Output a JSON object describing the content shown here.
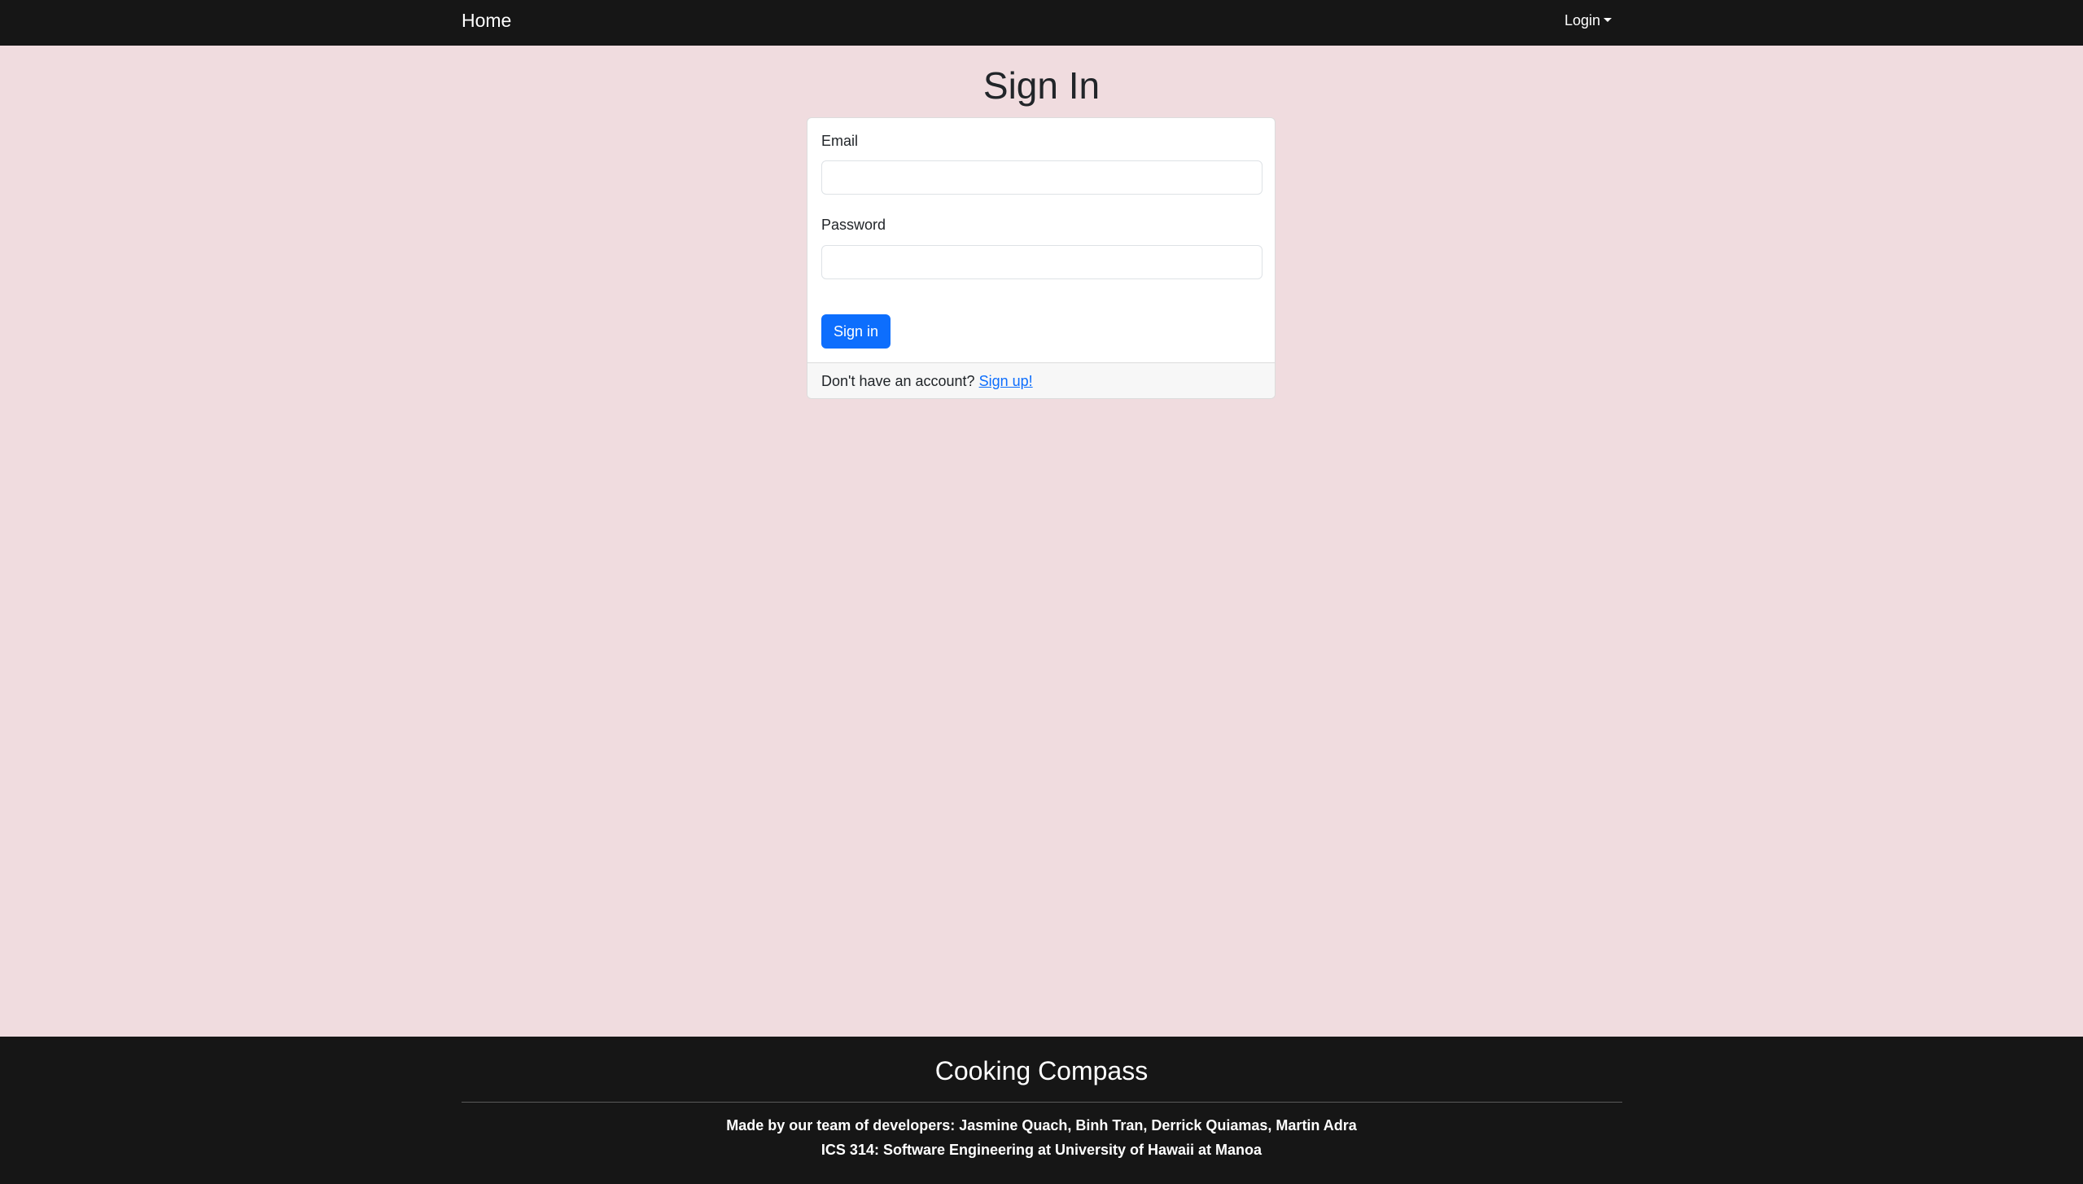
{
  "navbar": {
    "home_label": "Home",
    "login_label": "Login"
  },
  "signin": {
    "title": "Sign In",
    "email_label": "Email",
    "email_value": "",
    "password_label": "Password",
    "password_value": "",
    "submit_label": "Sign in",
    "footer_text": "Don't have an account?",
    "signup_link": "Sign up!"
  },
  "footer": {
    "title": "Cooking Compass",
    "credits": "Made by our team of developers: Jasmine Quach, Binh Tran, Derrick Quiamas, Martin Adra",
    "course": "ICS 314: Software Engineering at University of Hawaii at Manoa"
  },
  "colors": {
    "background": "#f0dcdf",
    "navbar": "#161616",
    "primary": "#0d6efd"
  },
  "icons": {
    "login_caret": "caret-down-icon"
  }
}
